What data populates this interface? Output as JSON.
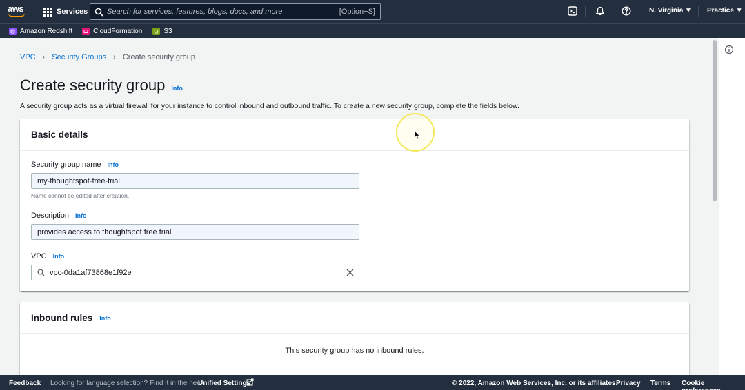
{
  "topnav": {
    "logo_text": "aws",
    "services_label": "Services",
    "search_placeholder": "Search for services, features, blogs, docs, and more",
    "search_shortcut": "[Option+S]",
    "region": "N. Virginia ▼",
    "account": "Practice ▼"
  },
  "favorites": [
    {
      "label": "Amazon Redshift",
      "color": "#8c4fff"
    },
    {
      "label": "CloudFormation",
      "color": "#e7157b"
    },
    {
      "label": "S3",
      "color": "#7aa116"
    }
  ],
  "breadcrumb": {
    "vpc": "VPC",
    "security_groups": "Security Groups",
    "current": "Create security group"
  },
  "page": {
    "title": "Create security group",
    "info": "Info",
    "description": "A security group acts as a virtual firewall for your instance to control inbound and outbound traffic. To create a new security group, complete the fields below."
  },
  "basic_details": {
    "title": "Basic details",
    "name_label": "Security group name",
    "name_info": "Info",
    "name_value": "my-thoughtspot-free-trial",
    "name_hint": "Name cannot be edited after creation.",
    "desc_label": "Description",
    "desc_info": "Info",
    "desc_value": "provides access to thoughtspot free trial",
    "vpc_label": "VPC",
    "vpc_info": "Info",
    "vpc_value": "vpc-0da1af73868e1f92e"
  },
  "inbound": {
    "title": "Inbound rules",
    "info": "Info",
    "empty": "This security group has no inbound rules."
  },
  "footer": {
    "feedback": "Feedback",
    "language_text": "Looking for language selection? Find it in the new",
    "unified_settings": "Unified Settings",
    "copyright": "© 2022, Amazon Web Services, Inc. or its affiliates.",
    "privacy": "Privacy",
    "terms": "Terms",
    "cookies": "Cookie preferences"
  },
  "colors": {
    "nav_bg": "#232f3e",
    "link": "#0972d3",
    "aws_orange": "#ff9900"
  }
}
